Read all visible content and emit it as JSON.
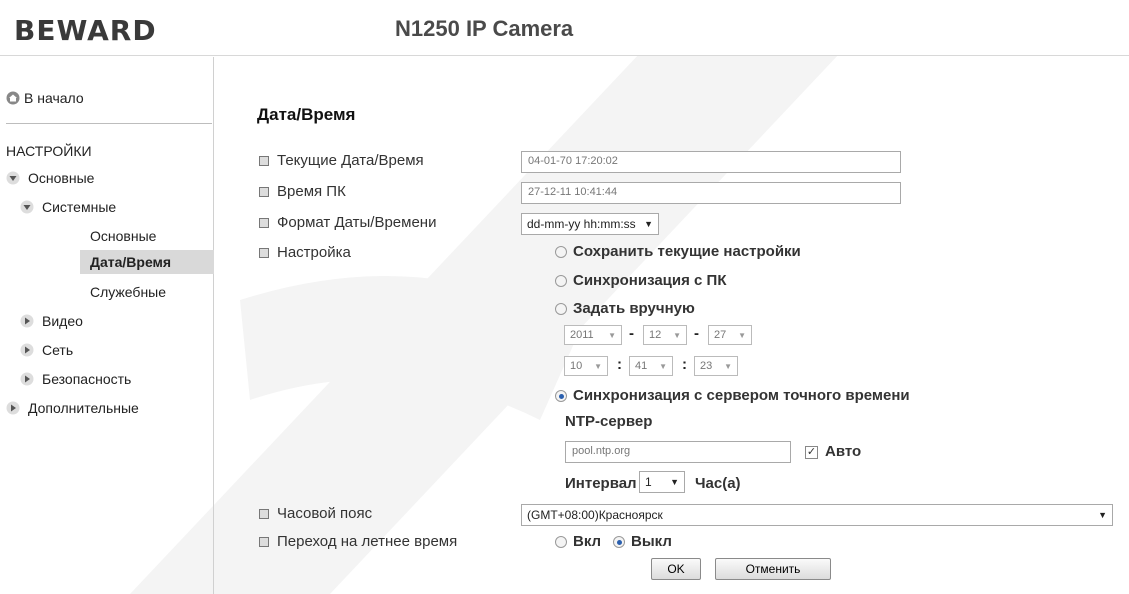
{
  "header": {
    "logo": "BEWARD",
    "camera_title": "N1250 IP Camera"
  },
  "sidebar": {
    "home": "В начало",
    "section": "НАСТРОЙКИ",
    "items": [
      {
        "label": "Основные"
      },
      {
        "label": "Системные"
      },
      {
        "label": "Основные"
      },
      {
        "label": "Дата/Время"
      },
      {
        "label": "Служебные"
      },
      {
        "label": "Видео"
      },
      {
        "label": "Сеть"
      },
      {
        "label": "Безопасность"
      },
      {
        "label": "Дополнительные"
      }
    ]
  },
  "main": {
    "title": "Дата/Время",
    "current_label": "Текущие Дата/Время",
    "current_value": "04-01-70   17:20:02",
    "pc_label": "Время ПК",
    "pc_value": "27-12-11   10:41:44",
    "format_label": "Формат Даты/Времени",
    "format_value": "dd-mm-yy hh:mm:ss",
    "setting_label": "Настройка",
    "opt_keep": "Сохранить текущие настройки",
    "opt_sync_pc": "Синхронизация с ПК",
    "opt_manual": "Задать вручную",
    "year": "2011",
    "month": "12",
    "day": "27",
    "hour": "10",
    "minute": "41",
    "second": "23",
    "date_sep": "-",
    "time_sep": ":",
    "opt_ntp": "Синхронизация с сервером точного времени",
    "ntp_label": "NTP-сервер",
    "ntp_value": "pool.ntp.org",
    "auto_label": "Авто",
    "interval_label": "Интервал",
    "interval_value": "1",
    "interval_unit": "Час(а)",
    "tz_label": "Часовой пояс",
    "tz_value": "(GMT+08:00)Красноярск",
    "dst_label": "Переход на летнее время",
    "dst_on": "Вкл",
    "dst_off": "Выкл",
    "ok": "OK",
    "cancel": "Отменить"
  }
}
